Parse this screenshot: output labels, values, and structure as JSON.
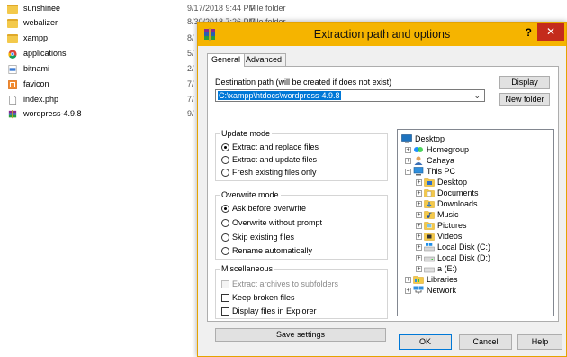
{
  "background": {
    "files": [
      {
        "name": "sunshinee",
        "icon": "folder-icon",
        "date": "9/17/2018 9:44 PM",
        "type": "File folder"
      },
      {
        "name": "webalizer",
        "icon": "folder-icon",
        "date": "8/30/2018 7:26 PM",
        "type": "File folder"
      },
      {
        "name": "xampp",
        "icon": "folder-icon",
        "date": "8/",
        "type": ""
      },
      {
        "name": "applications",
        "icon": "chrome-icon",
        "date": "5/",
        "type": ""
      },
      {
        "name": "bitnami",
        "icon": "css-file-icon",
        "date": "2/",
        "type": ""
      },
      {
        "name": "favicon",
        "icon": "image-icon",
        "date": "7/",
        "type": ""
      },
      {
        "name": "index.php",
        "icon": "file-icon",
        "date": "7/",
        "type": ""
      },
      {
        "name": "wordpress-4.9.8",
        "icon": "winrar-archive-icon",
        "date": "9/",
        "type": ""
      }
    ]
  },
  "dialog": {
    "title": "Extraction path and options",
    "help": "?",
    "close": "✕",
    "tabs": [
      "General",
      "Advanced"
    ],
    "destination_label": "Destination path (will be created if does not exist)",
    "destination_value": "C:\\xampp\\htdocs\\wordpress-4.9.8",
    "display_button": "Display",
    "new_folder_button": "New folder",
    "update_mode": {
      "title": "Update mode",
      "options": [
        "Extract and replace files",
        "Extract and update files",
        "Fresh existing files only"
      ],
      "selected": 0
    },
    "overwrite_mode": {
      "title": "Overwrite mode",
      "options": [
        "Ask before overwrite",
        "Overwrite without prompt",
        "Skip existing files",
        "Rename automatically"
      ],
      "selected": 0
    },
    "misc": {
      "title": "Miscellaneous",
      "options": [
        "Extract archives to subfolders",
        "Keep broken files",
        "Display files in Explorer"
      ]
    },
    "save_settings": "Save settings",
    "tree": [
      "Desktop",
      "Homegroup",
      "Cahaya",
      "This PC",
      "Desktop",
      "Documents",
      "Downloads",
      "Music",
      "Pictures",
      "Videos",
      "Local Disk (C:)",
      "Local Disk (D:)",
      "a (E:)",
      "Libraries",
      "Network"
    ],
    "ok": "OK",
    "cancel": "Cancel",
    "help_button": "Help"
  },
  "colors": {
    "titlebar": "#f5b400",
    "close": "#c42b1c",
    "selection": "#0078d7"
  }
}
